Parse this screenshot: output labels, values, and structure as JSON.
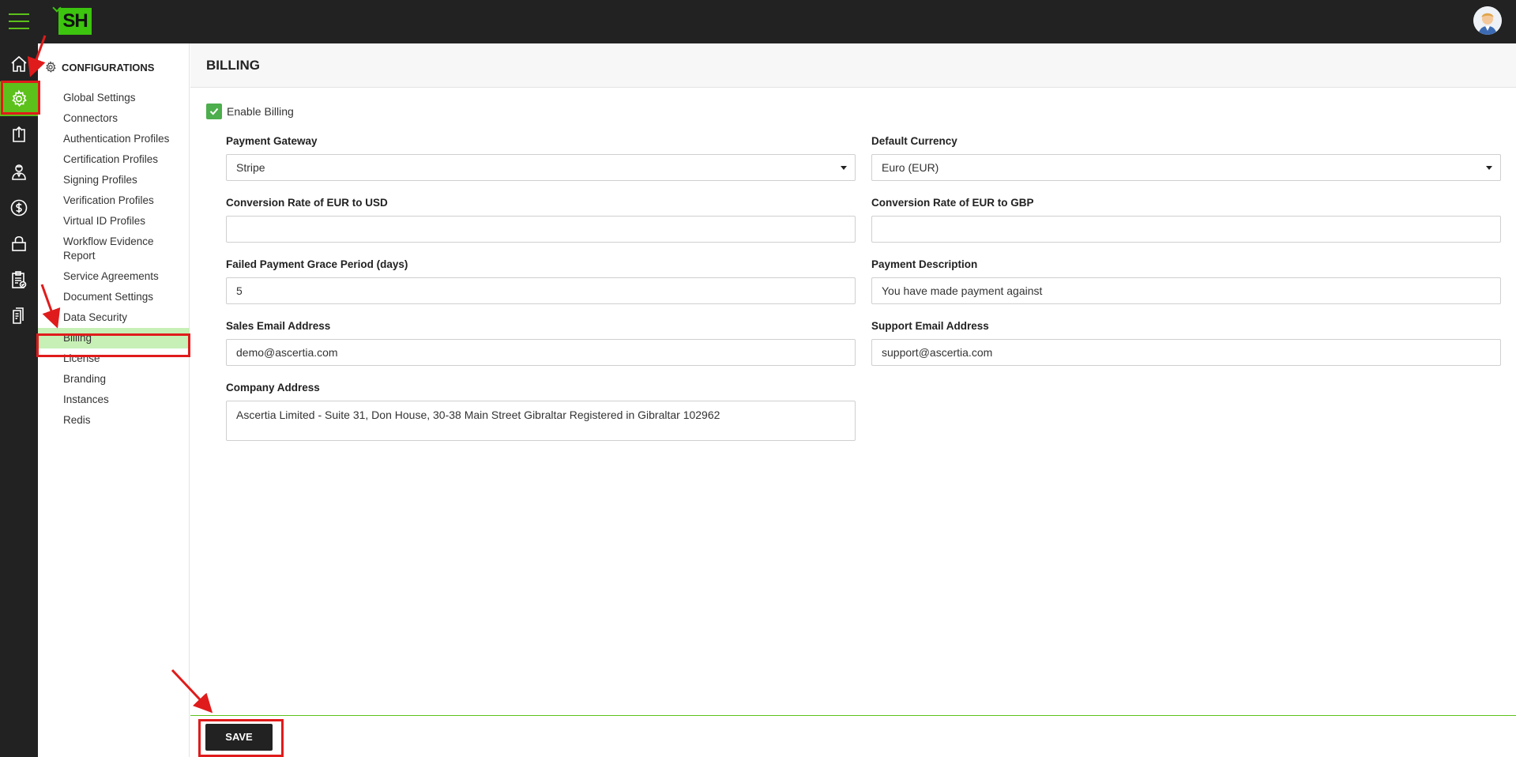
{
  "topbar": {
    "logo_text": "SH",
    "menu_icon": "hamburger-icon",
    "avatar_icon": "user-avatar"
  },
  "rail": {
    "items": [
      {
        "name": "home",
        "icon": "home-icon"
      },
      {
        "name": "configurations",
        "icon": "gear-icon",
        "active": true
      },
      {
        "name": "upload",
        "icon": "upload-icon"
      },
      {
        "name": "users",
        "icon": "user-icon"
      },
      {
        "name": "billing",
        "icon": "dollar-icon"
      },
      {
        "name": "security",
        "icon": "lock-icon"
      },
      {
        "name": "reports",
        "icon": "clipboard-check-icon"
      },
      {
        "name": "documents",
        "icon": "document-icon"
      }
    ]
  },
  "sidebar": {
    "title": "CONFIGURATIONS",
    "items": [
      {
        "label": "Global Settings"
      },
      {
        "label": "Connectors"
      },
      {
        "label": "Authentication Profiles"
      },
      {
        "label": "Certification Profiles"
      },
      {
        "label": "Signing Profiles"
      },
      {
        "label": "Verification Profiles"
      },
      {
        "label": "Virtual ID Profiles"
      },
      {
        "label": "Workflow Evidence Report"
      },
      {
        "label": "Service Agreements"
      },
      {
        "label": "Document Settings"
      },
      {
        "label": "Data Security"
      },
      {
        "label": "Billing",
        "active": true
      },
      {
        "label": "License"
      },
      {
        "label": "Branding"
      },
      {
        "label": "Instances"
      },
      {
        "label": "Redis"
      }
    ]
  },
  "main": {
    "title": "BILLING",
    "enable_billing": {
      "label": "Enable Billing",
      "checked": true
    },
    "fields": {
      "payment_gateway": {
        "label": "Payment Gateway",
        "value": "Stripe"
      },
      "default_currency": {
        "label": "Default Currency",
        "value": "Euro (EUR)"
      },
      "rate_usd": {
        "label": "Conversion Rate of EUR to USD",
        "value": ""
      },
      "rate_gbp": {
        "label": "Conversion Rate of EUR to GBP",
        "value": ""
      },
      "grace_period": {
        "label": "Failed Payment Grace Period (days)",
        "value": "5"
      },
      "payment_description": {
        "label": "Payment Description",
        "value": "You have made payment against"
      },
      "sales_email": {
        "label": "Sales Email Address",
        "value": "demo@ascertia.com"
      },
      "support_email": {
        "label": "Support Email Address",
        "value": "support@ascertia.com"
      },
      "company_address": {
        "label": "Company Address",
        "value": "Ascertia Limited - Suite 31, Don House, 30-38 Main Street Gibraltar Registered in Gibraltar 102962"
      }
    }
  },
  "footer": {
    "save_label": "SAVE"
  },
  "colors": {
    "accent": "#5cc11a",
    "dark": "#222222",
    "active_bg": "#c6f0b6",
    "annotation": "#e01b1b"
  }
}
